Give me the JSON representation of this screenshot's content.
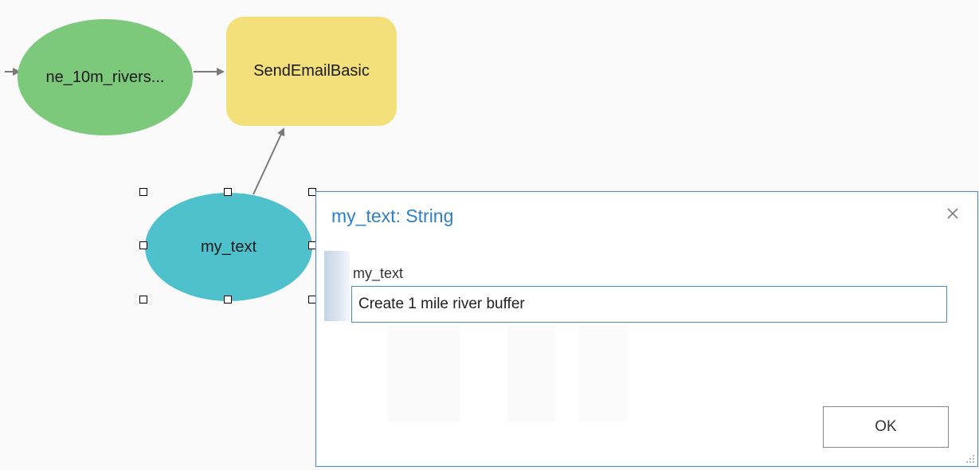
{
  "model": {
    "nodes": {
      "rivers": {
        "label": "ne_10m_rivers...",
        "color": "#7dc97c"
      },
      "send_email": {
        "label": "SendEmailBasic",
        "color": "#f3e07a"
      },
      "my_text": {
        "label": "my_text",
        "color": "#4fc1cd",
        "selected": true
      }
    },
    "connector_color": "#7a7a7a"
  },
  "dialog": {
    "title": "my_text: String",
    "close_icon": "close-icon",
    "field_label": "my_text",
    "field_value": "Create 1 mile river buffer",
    "ok_label": "OK",
    "accent_color": "#2f7fc4"
  }
}
